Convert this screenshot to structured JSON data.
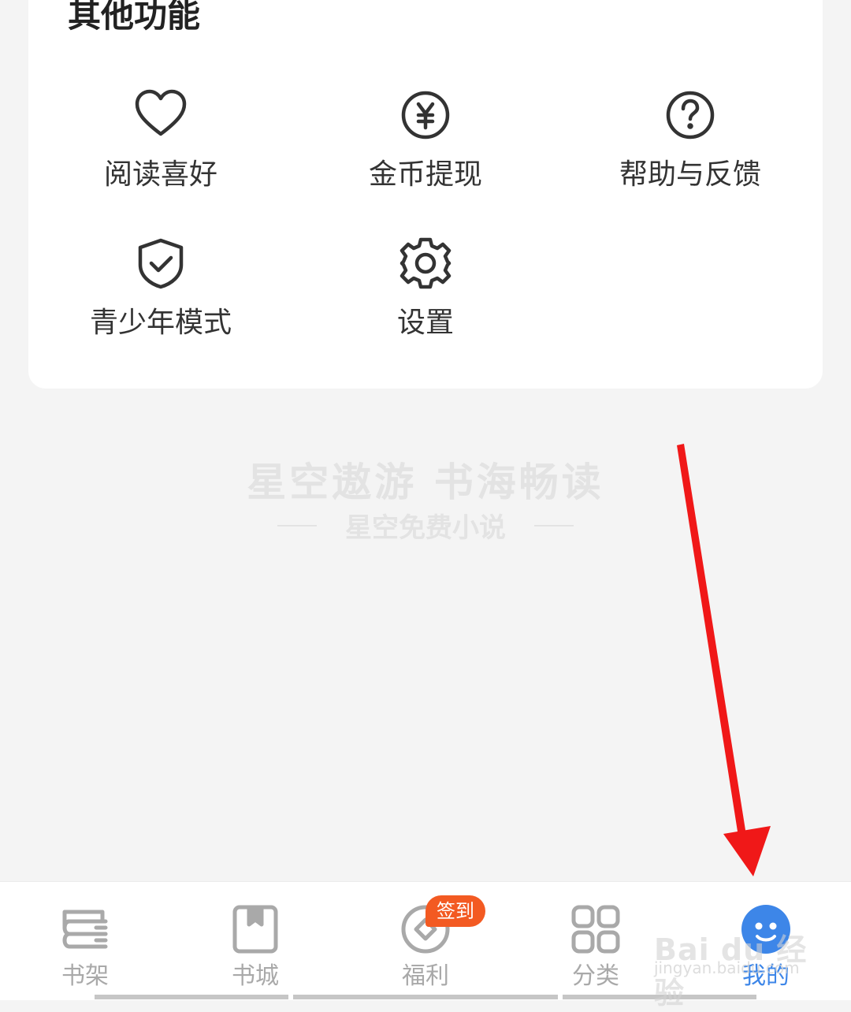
{
  "section": {
    "title": "其他功能"
  },
  "features": [
    {
      "label": "阅读喜好",
      "icon": "heart-icon"
    },
    {
      "label": "金币提现",
      "icon": "yuan-coin-icon"
    },
    {
      "label": "帮助与反馈",
      "icon": "question-circle-icon"
    },
    {
      "label": "青少年模式",
      "icon": "shield-check-icon"
    },
    {
      "label": "设置",
      "icon": "gear-icon"
    }
  ],
  "slogan": {
    "main": "星空遨游 书海畅读",
    "sub": "星空免费小说"
  },
  "tabs": [
    {
      "label": "书架",
      "icon": "bookshelf-icon"
    },
    {
      "label": "书城",
      "icon": "book-icon"
    },
    {
      "label": "福利",
      "icon": "coin-icon",
      "badge": "签到"
    },
    {
      "label": "分类",
      "icon": "grid-icon"
    },
    {
      "label": "我的",
      "icon": "profile-face-icon",
      "active": true
    }
  ],
  "watermark": {
    "logo": "Bai du 经验",
    "url": "jingyan.baidu.com"
  },
  "colors": {
    "accent": "#3d86e8",
    "badge": "#f35a22",
    "annotation_arrow": "#f01818",
    "inactive": "#a9a9a9"
  }
}
